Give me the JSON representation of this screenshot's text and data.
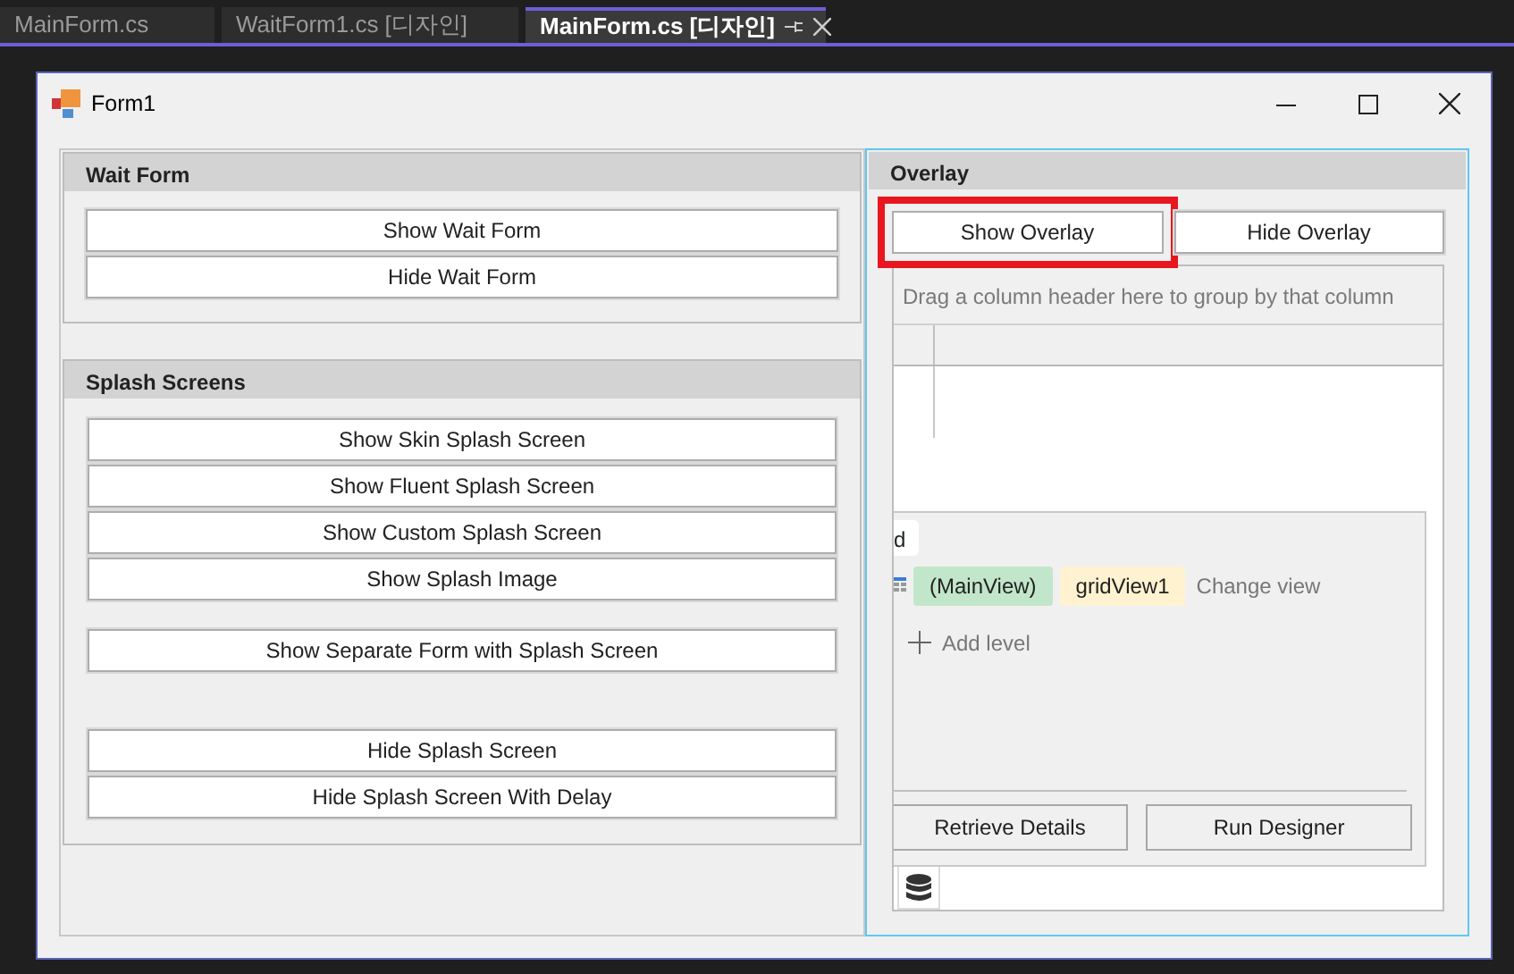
{
  "ide_tabs": [
    {
      "label": "MainForm.cs",
      "selected": false,
      "closable": false
    },
    {
      "label": "WaitForm1.cs [디자인]",
      "selected": false,
      "closable": false
    },
    {
      "label": "MainForm.cs [디자인]",
      "selected": true,
      "closable": true
    }
  ],
  "window": {
    "title": "Form1"
  },
  "wait_form": {
    "title": "Wait Form",
    "buttons": [
      "Show Wait Form",
      "Hide Wait Form"
    ]
  },
  "splash_screens": {
    "title": "Splash Screens",
    "button_groups": [
      [
        "Show Skin Splash Screen",
        "Show Fluent Splash Screen",
        "Show Custom Splash Screen",
        "Show Splash Image"
      ],
      [
        "Show Separate Form with Splash Screen"
      ],
      [
        "Hide Splash Screen",
        "Hide Splash Screen With Delay"
      ]
    ]
  },
  "overlay": {
    "title": "Overlay",
    "buttons": [
      {
        "label": "Show Overlay",
        "highlighted": true
      },
      {
        "label": "Hide Overlay",
        "highlighted": false
      }
    ],
    "grid": {
      "group_panel": "Drag a column header here to group by that column",
      "designer": {
        "cut_text": "d",
        "levels": [
          {
            "label": "(MainView)",
            "color": "#c2e6c9"
          },
          {
            "label": "gridView1",
            "color": "#fff2d0"
          }
        ],
        "change_view": "Change view",
        "add_level": "Add level",
        "buttons": [
          "Retrieve Details",
          "Run Designer"
        ]
      }
    }
  }
}
